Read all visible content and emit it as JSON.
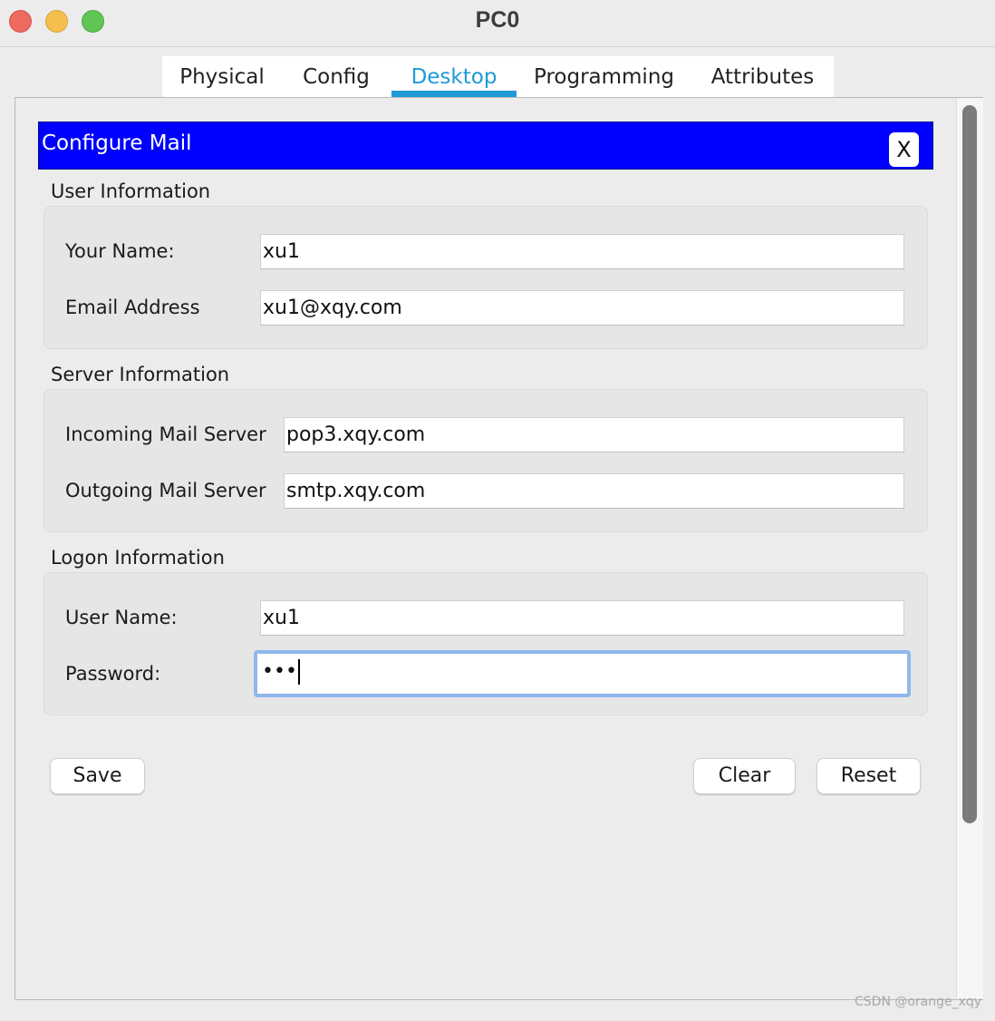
{
  "window": {
    "title": "PC0"
  },
  "tabs": [
    {
      "label": "Physical"
    },
    {
      "label": "Config"
    },
    {
      "label": "Desktop",
      "active": true
    },
    {
      "label": "Programming"
    },
    {
      "label": "Attributes"
    }
  ],
  "dialog": {
    "title": "Configure Mail",
    "close_label": "X",
    "header_color": "#0000ff"
  },
  "user_info": {
    "heading": "User Information",
    "name_label": "Your Name:",
    "name_value": "xu1",
    "email_label": "Email Address",
    "email_value": "xu1@xqy.com"
  },
  "server_info": {
    "heading": "Server Information",
    "incoming_label": "Incoming Mail Server",
    "incoming_value": "pop3.xqy.com",
    "outgoing_label": "Outgoing Mail Server",
    "outgoing_value": "smtp.xqy.com"
  },
  "logon_info": {
    "heading": "Logon Information",
    "username_label": "User Name:",
    "username_value": "xu1",
    "password_label": "Password:",
    "password_masked": "•••"
  },
  "buttons": {
    "save": "Save",
    "clear": "Clear",
    "reset": "Reset"
  },
  "watermark": "CSDN @orange_xqy",
  "colors": {
    "accent": "#1e9ad6",
    "focus_ring": "#8fb7ef"
  }
}
